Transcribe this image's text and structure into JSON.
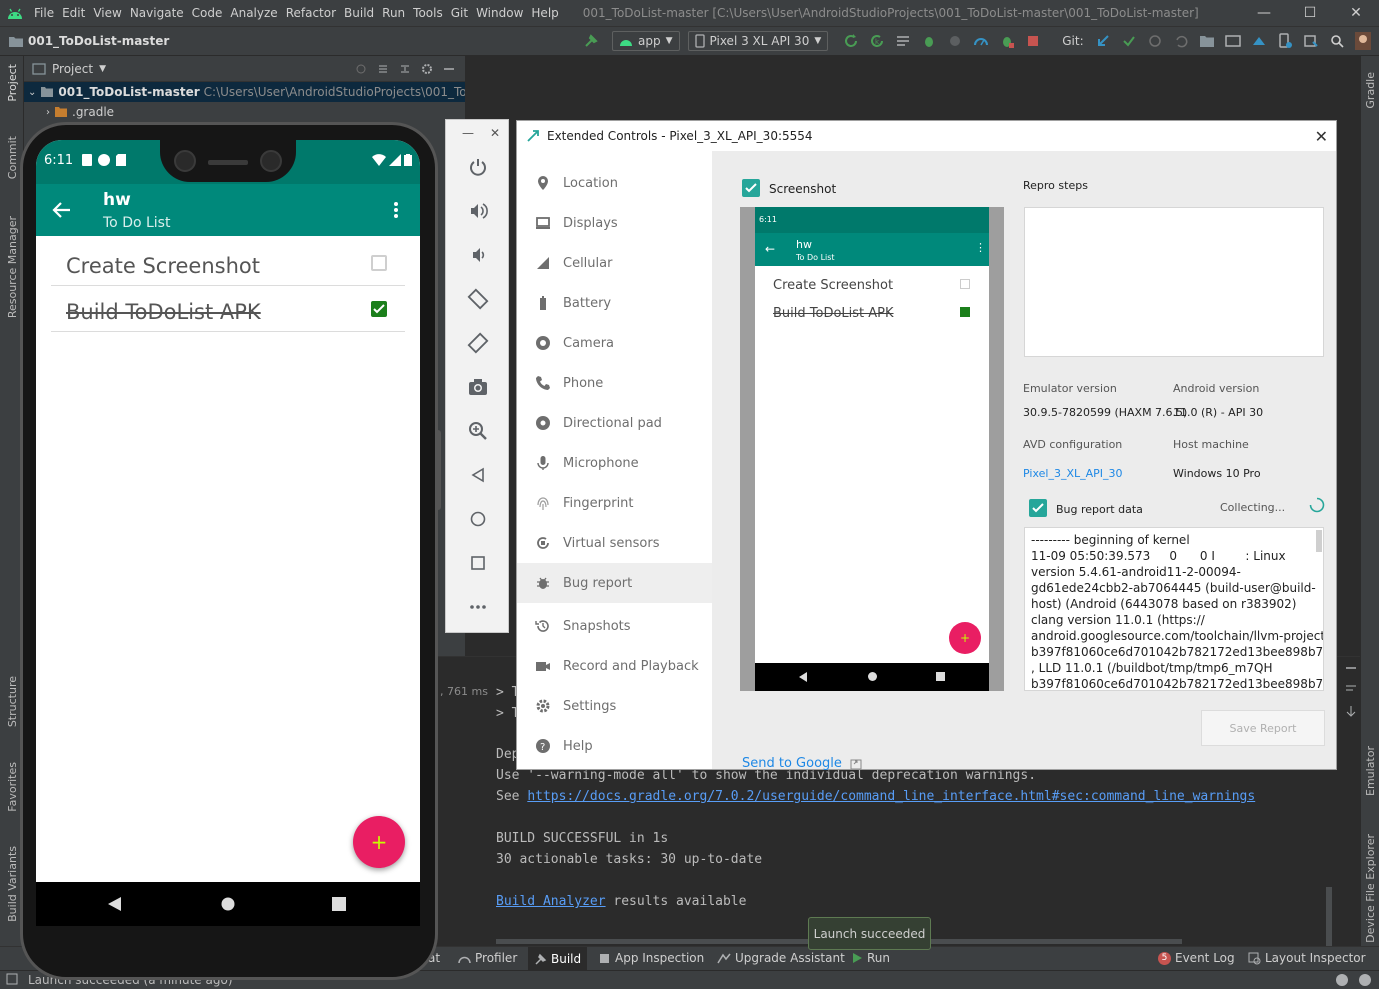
{
  "menubar": {
    "items": [
      "File",
      "Edit",
      "View",
      "Navigate",
      "Code",
      "Analyze",
      "Refactor",
      "Build",
      "Run",
      "Tools",
      "Git",
      "Window",
      "Help"
    ],
    "window_title": "001_ToDoList-master [C:\\Users\\User\\AndroidStudioProjects\\001_ToDoList-master\\001_ToDoList-master]"
  },
  "toolbar": {
    "project_name": "001_ToDoList-master",
    "run_config": "app",
    "device": "Pixel 3 XL API 30",
    "git_label": "Git:"
  },
  "left_tabs": [
    "Project",
    "Commit",
    "Resource Manager",
    "Structure",
    "Favorites",
    "Build Variants"
  ],
  "right_tabs": [
    "Gradle",
    "Emulator",
    "Device File Explorer"
  ],
  "project_panel": {
    "header": "Project",
    "root_name": "001_ToDoList-master",
    "root_path": "C:\\Users\\User\\AndroidStudioProjects\\001_ToDoList-",
    "child": ".gradle"
  },
  "console": {
    "timing": ", 761 ms",
    "prompt1": "> T",
    "prompt2": "> T",
    "dep": "Dep",
    "warn_line": "Use '--warning-mode all' to show the individual deprecation warnings.",
    "see_prefix": "See ",
    "see_link": "https://docs.gradle.org/7.0.2/userguide/command_line_interface.html#sec:command_line_warnings",
    "build_success": "BUILD SUCCESSFUL in 1s",
    "tasks": "30 actionable tasks: 30 up-to-date",
    "analyzer_link": "Build Analyzer",
    "analyzer_rest": " results available"
  },
  "bottom_tabs": {
    "partial": "at",
    "profiler": "Profiler",
    "build": "Build",
    "app_inspection": "App Inspection",
    "upgrade": "Upgrade Assistant",
    "run": "Run",
    "event_log": "Event Log",
    "event_count": "5",
    "layout_inspector": "Layout Inspector"
  },
  "status_bar": {
    "text": "Launch succeeded (a minute ago)"
  },
  "toast": {
    "text": "Launch succeeded"
  },
  "phone": {
    "time": "6:11",
    "app_title": "hw",
    "app_subtitle": "To Do List",
    "todos": [
      {
        "text": "Create Screenshot",
        "done": false
      },
      {
        "text": "Build ToDoList APK",
        "done": true
      }
    ],
    "fab": "+"
  },
  "ext_controls": {
    "title": "Extended Controls - Pixel_3_XL_API_30:5554",
    "nav": [
      {
        "label": "Location",
        "icon": "location-pin-icon"
      },
      {
        "label": "Displays",
        "icon": "display-icon"
      },
      {
        "label": "Cellular",
        "icon": "cellular-icon"
      },
      {
        "label": "Battery",
        "icon": "battery-icon"
      },
      {
        "label": "Camera",
        "icon": "camera-aperture-icon"
      },
      {
        "label": "Phone",
        "icon": "phone-icon"
      },
      {
        "label": "Directional pad",
        "icon": "dpad-icon"
      },
      {
        "label": "Microphone",
        "icon": "microphone-icon"
      },
      {
        "label": "Fingerprint",
        "icon": "fingerprint-icon"
      },
      {
        "label": "Virtual sensors",
        "icon": "rotation-icon"
      },
      {
        "label": "Bug report",
        "icon": "bug-icon"
      },
      {
        "label": "Snapshots",
        "icon": "history-icon"
      },
      {
        "label": "Record and Playback",
        "icon": "video-icon"
      },
      {
        "label": "Settings",
        "icon": "gear-icon"
      },
      {
        "label": "Help",
        "icon": "help-icon"
      }
    ],
    "active_nav": "Bug report",
    "screenshot_label": "Screenshot",
    "repro_steps_label": "Repro steps",
    "emulator_version_label": "Emulator version",
    "emulator_version": "30.9.5-7820599 (HAXM 7.6.5)",
    "android_version_label": "Android version",
    "android_version": "11.0 (R) - API 30",
    "avd_config_label": "AVD configuration",
    "avd_config": "Pixel_3_XL_API_30",
    "host_machine_label": "Host machine",
    "host_machine": "Windows 10 Pro",
    "bug_report_data_label": "Bug report data",
    "collecting": "Collecting...",
    "log_lines": [
      "--------- beginning of kernel",
      "11-09 05:50:39.573     0      0 I        : Linux",
      "version 5.4.61-android11-2-00094-",
      "gd61ede24cbb2-ab7064445 (build-user@build-",
      "host) (Android (6443078 based on r383902)",
      "clang version 11.0.1 (https://",
      "android.googlesource.com/toolchain/llvm-project",
      "b397f81060ce6d701042b782172ed13bee898b79)",
      ", LLD 11.0.1 (/buildbot/tmp/tmp6_m7QH",
      "b397f81060ce6d701042b782172ed13bee898b79)"
    ],
    "send_to_google": "Send to Google",
    "save_report": "Save Report"
  },
  "colors": {
    "ide_bg": "#2b2b2b",
    "ide_panel": "#3c3f41",
    "teal_dark": "#00796b",
    "teal": "#00897b",
    "fab": "#e91e63",
    "link": "#589df6",
    "checked": "#1b7f1b"
  }
}
